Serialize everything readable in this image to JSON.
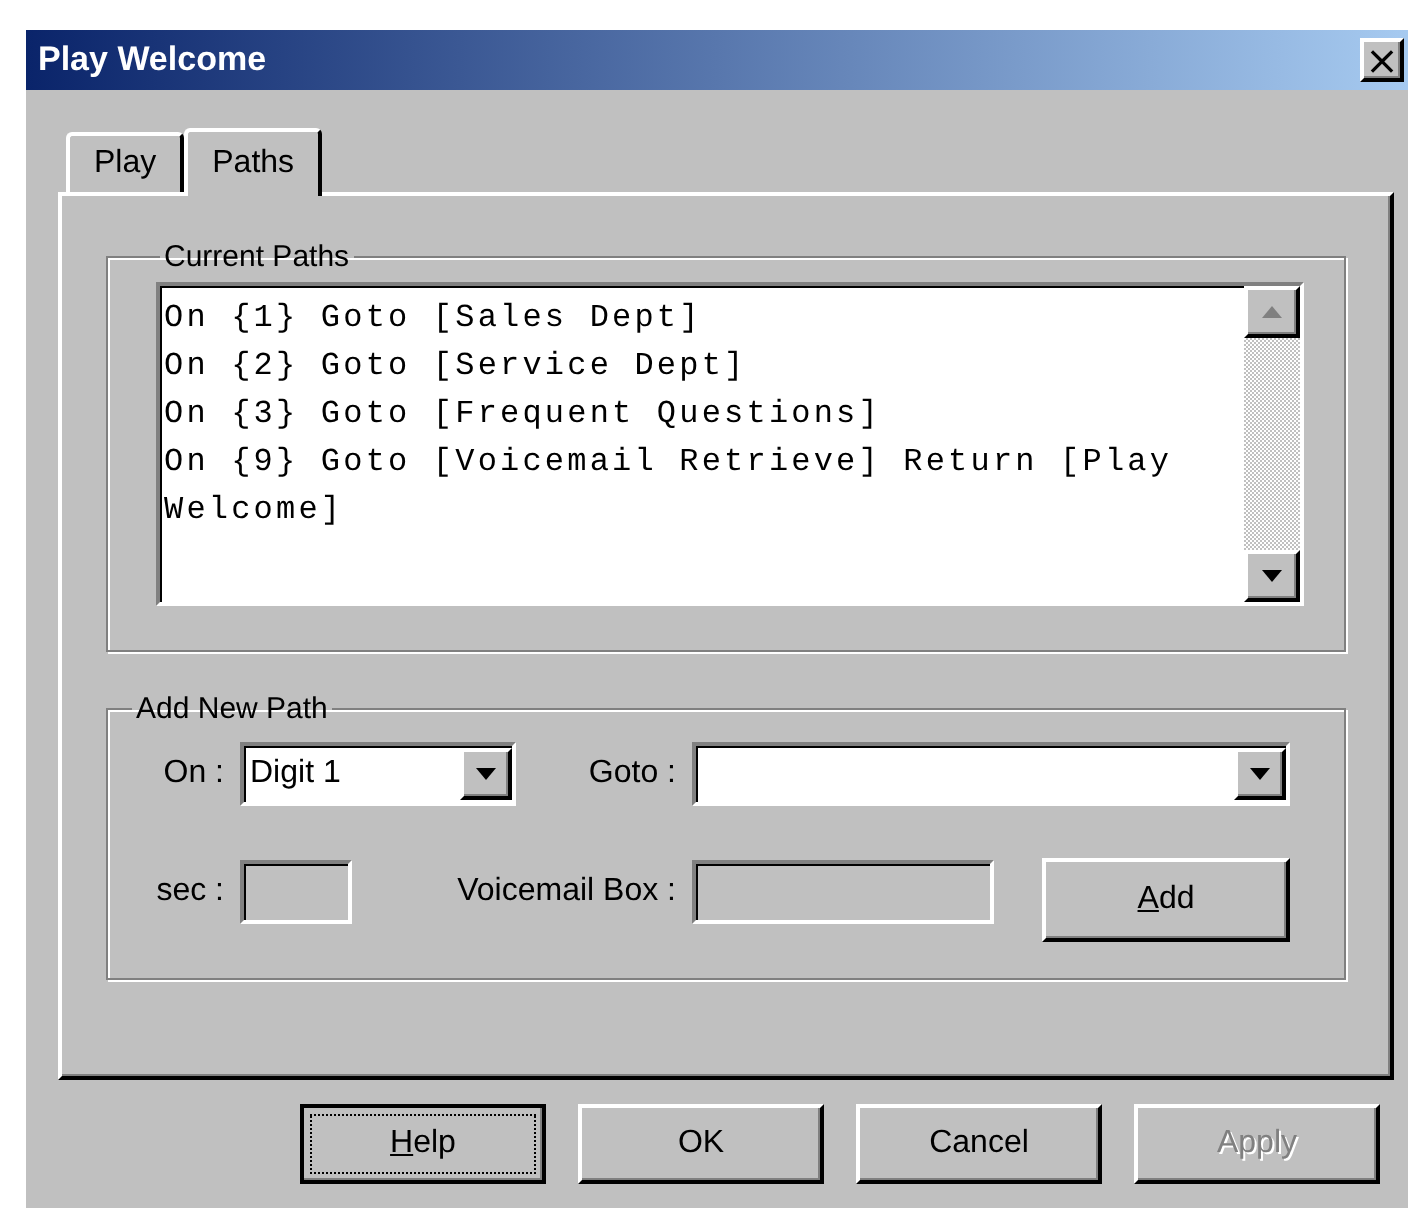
{
  "window": {
    "title": "Play Welcome",
    "close": "×"
  },
  "tabs": [
    {
      "label": "Play",
      "selected": false
    },
    {
      "label": "Paths",
      "selected": true
    }
  ],
  "current_paths": {
    "label": "Current Paths",
    "lines": [
      "On {1} Goto [Sales Dept]",
      "On {2} Goto [Service Dept]",
      "On {3} Goto [Frequent Questions]",
      "On {9} Goto [Voicemail Retrieve] Return [Play Welcome]"
    ]
  },
  "add_new_path": {
    "label": "Add New Path",
    "on": {
      "label": "On :",
      "value": "Digit 1"
    },
    "goto": {
      "label": "Goto :"
    },
    "sec": {
      "label": "sec :",
      "disabled": true
    },
    "voicemail_box": {
      "label": "Voicemail Box :",
      "disabled": true
    },
    "add_button": {
      "accel": "A",
      "rest": "dd"
    }
  },
  "buttons": [
    {
      "accel": "H",
      "rest": "elp",
      "focused": true,
      "disabled": false
    },
    {
      "rest": "OK",
      "focused": false,
      "disabled": false
    },
    {
      "rest": "Cancel",
      "focused": false,
      "disabled": false
    },
    {
      "rest": "Apply",
      "focused": false,
      "disabled": true
    }
  ]
}
